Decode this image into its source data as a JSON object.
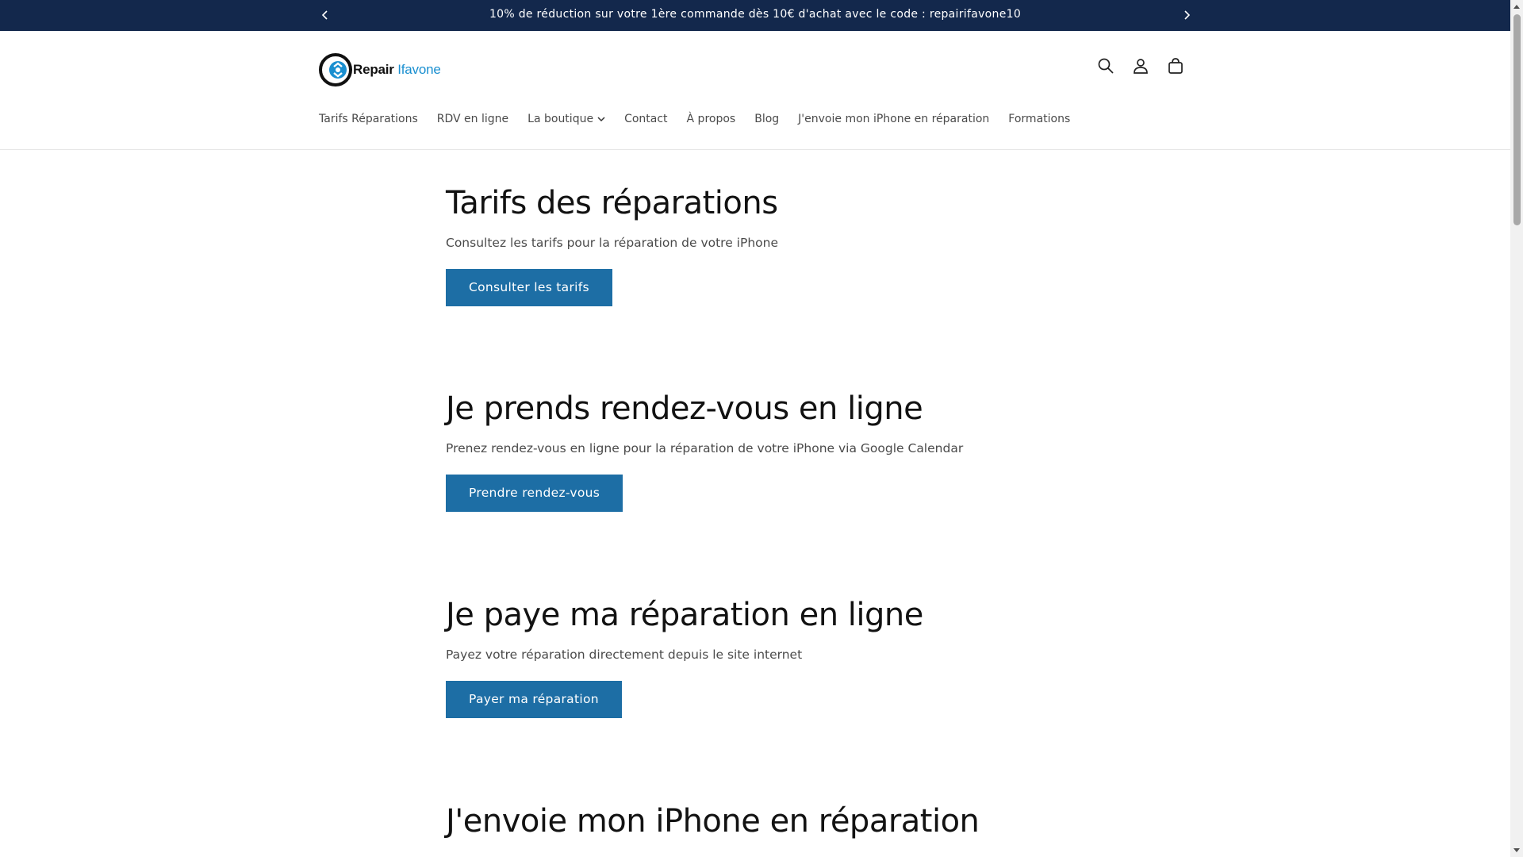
{
  "announcement": {
    "text": "10% de réduction sur votre 1ère commande dès 10€ d'achat avec le code : repairifavone10"
  },
  "logo": {
    "text_a": "Repair",
    "text_b": "Ifavone",
    "icon": "recycle-phone-logo-icon"
  },
  "header_icons": [
    "search-icon",
    "account-icon",
    "cart-icon"
  ],
  "nav": {
    "items": [
      {
        "label": "Tarifs Réparations"
      },
      {
        "label": "RDV en ligne"
      },
      {
        "label": "La boutique",
        "has_dropdown": true
      },
      {
        "label": "Contact"
      },
      {
        "label": "À propos"
      },
      {
        "label": "Blog"
      },
      {
        "label": "J'envoie mon iPhone en réparation"
      },
      {
        "label": "Formations"
      }
    ]
  },
  "sections": [
    {
      "title": "Tarifs des réparations",
      "text": "Consultez les tarifs pour la réparation de votre iPhone",
      "button": "Consulter les tarifs"
    },
    {
      "title": "Je prends rendez-vous en ligne",
      "text": "Prenez rendez-vous en ligne pour la réparation de votre iPhone via Google Calendar",
      "button": "Prendre rendez-vous"
    },
    {
      "title": "Je paye ma réparation en ligne",
      "text": "Payez votre réparation directement depuis le site internet",
      "button": "Payer ma réparation"
    },
    {
      "title": "J'envoie mon iPhone en réparation"
    }
  ],
  "colors": {
    "announcement_bg": "#13284c",
    "button_bg": "#1d6ea5",
    "logo_accent": "#1a8fd0"
  }
}
